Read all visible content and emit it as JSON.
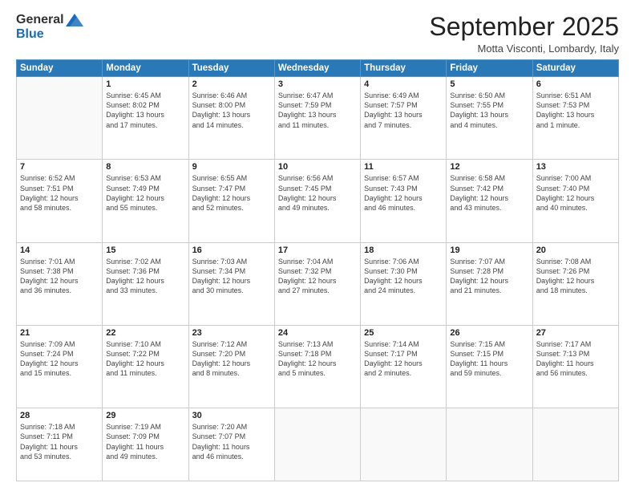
{
  "header": {
    "logo_general": "General",
    "logo_blue": "Blue",
    "month_title": "September 2025",
    "location": "Motta Visconti, Lombardy, Italy"
  },
  "weekdays": [
    "Sunday",
    "Monday",
    "Tuesday",
    "Wednesday",
    "Thursday",
    "Friday",
    "Saturday"
  ],
  "weeks": [
    [
      {
        "day": "",
        "info": ""
      },
      {
        "day": "1",
        "info": "Sunrise: 6:45 AM\nSunset: 8:02 PM\nDaylight: 13 hours\nand 17 minutes."
      },
      {
        "day": "2",
        "info": "Sunrise: 6:46 AM\nSunset: 8:00 PM\nDaylight: 13 hours\nand 14 minutes."
      },
      {
        "day": "3",
        "info": "Sunrise: 6:47 AM\nSunset: 7:59 PM\nDaylight: 13 hours\nand 11 minutes."
      },
      {
        "day": "4",
        "info": "Sunrise: 6:49 AM\nSunset: 7:57 PM\nDaylight: 13 hours\nand 7 minutes."
      },
      {
        "day": "5",
        "info": "Sunrise: 6:50 AM\nSunset: 7:55 PM\nDaylight: 13 hours\nand 4 minutes."
      },
      {
        "day": "6",
        "info": "Sunrise: 6:51 AM\nSunset: 7:53 PM\nDaylight: 13 hours\nand 1 minute."
      }
    ],
    [
      {
        "day": "7",
        "info": "Sunrise: 6:52 AM\nSunset: 7:51 PM\nDaylight: 12 hours\nand 58 minutes."
      },
      {
        "day": "8",
        "info": "Sunrise: 6:53 AM\nSunset: 7:49 PM\nDaylight: 12 hours\nand 55 minutes."
      },
      {
        "day": "9",
        "info": "Sunrise: 6:55 AM\nSunset: 7:47 PM\nDaylight: 12 hours\nand 52 minutes."
      },
      {
        "day": "10",
        "info": "Sunrise: 6:56 AM\nSunset: 7:45 PM\nDaylight: 12 hours\nand 49 minutes."
      },
      {
        "day": "11",
        "info": "Sunrise: 6:57 AM\nSunset: 7:43 PM\nDaylight: 12 hours\nand 46 minutes."
      },
      {
        "day": "12",
        "info": "Sunrise: 6:58 AM\nSunset: 7:42 PM\nDaylight: 12 hours\nand 43 minutes."
      },
      {
        "day": "13",
        "info": "Sunrise: 7:00 AM\nSunset: 7:40 PM\nDaylight: 12 hours\nand 40 minutes."
      }
    ],
    [
      {
        "day": "14",
        "info": "Sunrise: 7:01 AM\nSunset: 7:38 PM\nDaylight: 12 hours\nand 36 minutes."
      },
      {
        "day": "15",
        "info": "Sunrise: 7:02 AM\nSunset: 7:36 PM\nDaylight: 12 hours\nand 33 minutes."
      },
      {
        "day": "16",
        "info": "Sunrise: 7:03 AM\nSunset: 7:34 PM\nDaylight: 12 hours\nand 30 minutes."
      },
      {
        "day": "17",
        "info": "Sunrise: 7:04 AM\nSunset: 7:32 PM\nDaylight: 12 hours\nand 27 minutes."
      },
      {
        "day": "18",
        "info": "Sunrise: 7:06 AM\nSunset: 7:30 PM\nDaylight: 12 hours\nand 24 minutes."
      },
      {
        "day": "19",
        "info": "Sunrise: 7:07 AM\nSunset: 7:28 PM\nDaylight: 12 hours\nand 21 minutes."
      },
      {
        "day": "20",
        "info": "Sunrise: 7:08 AM\nSunset: 7:26 PM\nDaylight: 12 hours\nand 18 minutes."
      }
    ],
    [
      {
        "day": "21",
        "info": "Sunrise: 7:09 AM\nSunset: 7:24 PM\nDaylight: 12 hours\nand 15 minutes."
      },
      {
        "day": "22",
        "info": "Sunrise: 7:10 AM\nSunset: 7:22 PM\nDaylight: 12 hours\nand 11 minutes."
      },
      {
        "day": "23",
        "info": "Sunrise: 7:12 AM\nSunset: 7:20 PM\nDaylight: 12 hours\nand 8 minutes."
      },
      {
        "day": "24",
        "info": "Sunrise: 7:13 AM\nSunset: 7:18 PM\nDaylight: 12 hours\nand 5 minutes."
      },
      {
        "day": "25",
        "info": "Sunrise: 7:14 AM\nSunset: 7:17 PM\nDaylight: 12 hours\nand 2 minutes."
      },
      {
        "day": "26",
        "info": "Sunrise: 7:15 AM\nSunset: 7:15 PM\nDaylight: 11 hours\nand 59 minutes."
      },
      {
        "day": "27",
        "info": "Sunrise: 7:17 AM\nSunset: 7:13 PM\nDaylight: 11 hours\nand 56 minutes."
      }
    ],
    [
      {
        "day": "28",
        "info": "Sunrise: 7:18 AM\nSunset: 7:11 PM\nDaylight: 11 hours\nand 53 minutes."
      },
      {
        "day": "29",
        "info": "Sunrise: 7:19 AM\nSunset: 7:09 PM\nDaylight: 11 hours\nand 49 minutes."
      },
      {
        "day": "30",
        "info": "Sunrise: 7:20 AM\nSunset: 7:07 PM\nDaylight: 11 hours\nand 46 minutes."
      },
      {
        "day": "",
        "info": ""
      },
      {
        "day": "",
        "info": ""
      },
      {
        "day": "",
        "info": ""
      },
      {
        "day": "",
        "info": ""
      }
    ]
  ]
}
